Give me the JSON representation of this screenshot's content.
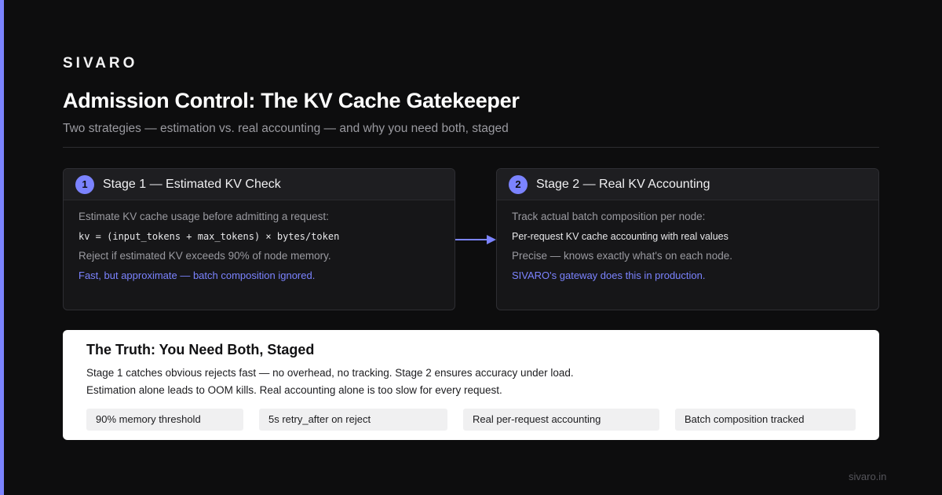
{
  "brand": "SIVARO",
  "title": "Admission Control: The KV Cache Gatekeeper",
  "subtitle": "Two strategies — estimation vs. real accounting — and why you need both, staged",
  "accent_color": "#7b83ff",
  "stages": [
    {
      "number": "1",
      "title": "Stage 1 — Estimated KV Check",
      "lines": [
        "Estimate KV cache usage before admitting a request:",
        "kv = (input_tokens + max_tokens) × bytes/token",
        "Reject if estimated KV exceeds 90% of node memory.",
        "Fast, but approximate — batch composition ignored."
      ]
    },
    {
      "number": "2",
      "title": "Stage 2 — Real KV Accounting",
      "lines": [
        "Track actual batch composition per node:",
        "Per-request KV cache accounting with real values",
        "Precise — knows exactly what's on each node.",
        "SIVARO's gateway does this in production."
      ]
    }
  ],
  "arrow_icon": "arrow-right-icon",
  "truth": {
    "title": "The Truth: You Need Both, Staged",
    "line1": "Stage 1 catches obvious rejects fast — no overhead, no tracking. Stage 2 ensures accuracy under load.",
    "line2": "Estimation alone leads to OOM kills. Real accounting alone is too slow for every request.",
    "chips": [
      "90% memory threshold",
      "5s retry_after on reject",
      "Real per-request accounting",
      "Batch composition tracked"
    ]
  },
  "footer": "sivaro.in"
}
